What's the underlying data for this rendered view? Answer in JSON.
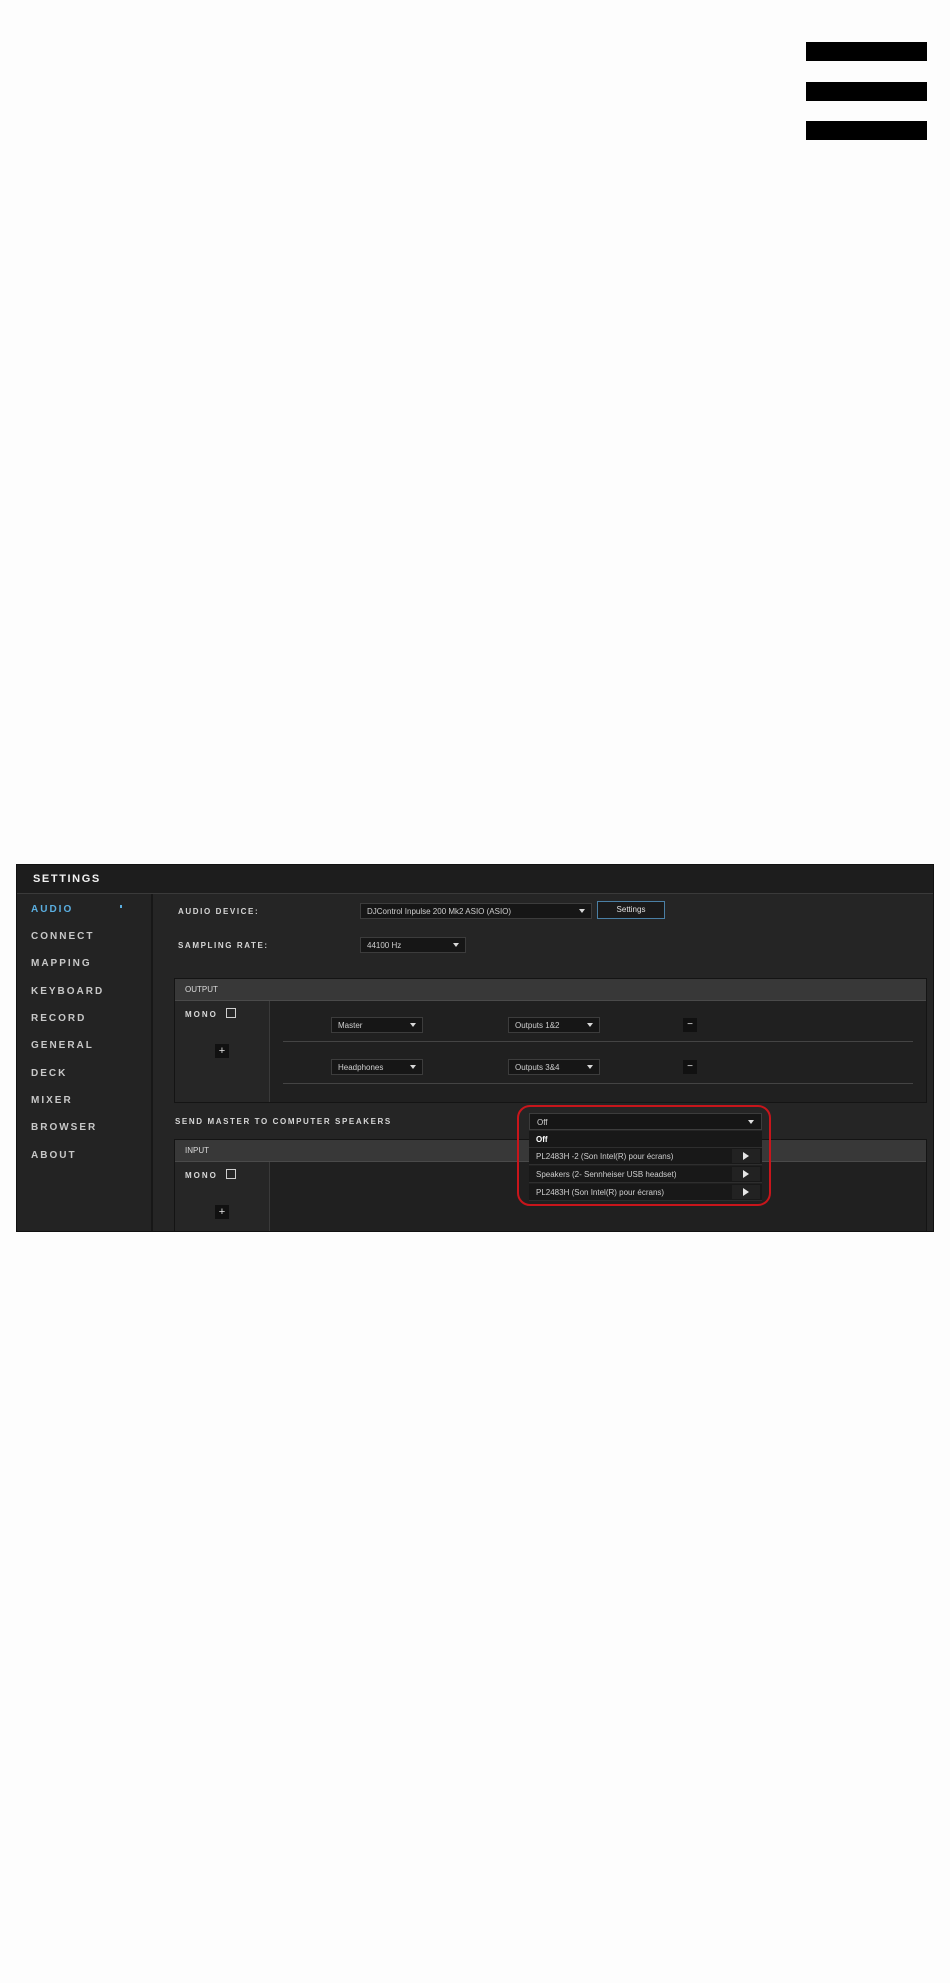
{
  "window": {
    "title": "SETTINGS"
  },
  "sidebar": {
    "items": [
      {
        "label": "AUDIO",
        "active": true
      },
      {
        "label": "CONNECT"
      },
      {
        "label": "MAPPING"
      },
      {
        "label": "KEYBOARD"
      },
      {
        "label": "RECORD"
      },
      {
        "label": "GENERAL"
      },
      {
        "label": "DECK"
      },
      {
        "label": "MIXER"
      },
      {
        "label": "BROWSER"
      },
      {
        "label": "ABOUT"
      }
    ]
  },
  "audio": {
    "device_label": "AUDIO DEVICE:",
    "device_value": "DJControl Inpulse 200 Mk2 ASIO (ASIO)",
    "settings_button": "Settings",
    "sampling_label": "SAMPLING RATE:",
    "sampling_value": "44100 Hz"
  },
  "output": {
    "header": "OUTPUT",
    "mono_label": "MONO",
    "add_label": "+",
    "rows": [
      {
        "channel": "Master",
        "route": "Outputs 1&2",
        "remove_label": "−"
      },
      {
        "channel": "Headphones",
        "route": "Outputs 3&4",
        "remove_label": "−"
      }
    ]
  },
  "send_master": {
    "label": "SEND MASTER TO COMPUTER SPEAKERS",
    "selected": "Off",
    "options": [
      "Off",
      "PL2483H -2 (Son Intel(R) pour écrans)",
      "Speakers (2- Sennheiser USB headset)",
      "PL2483H (Son Intel(R) pour écrans)"
    ]
  },
  "input": {
    "header": "INPUT",
    "mono_label": "MONO",
    "add_label": "+"
  },
  "colors": {
    "accent": "#5aaee0",
    "highlight": "#c8151b",
    "window_bg": "#252525"
  }
}
